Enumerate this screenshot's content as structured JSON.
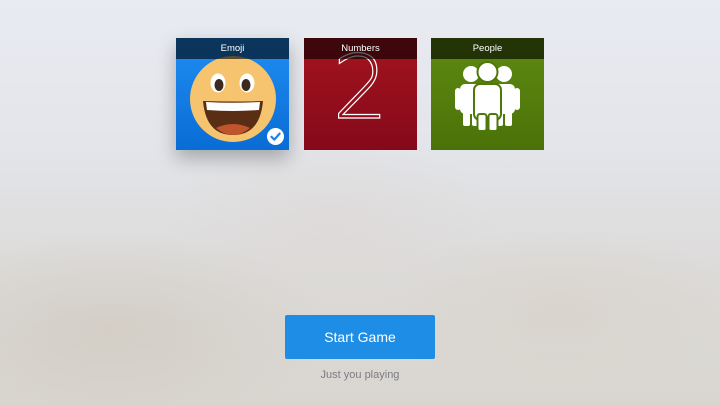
{
  "categories": [
    {
      "label": "Emoji",
      "icon": "smiley-emoji-icon",
      "color": "#1a84ec",
      "selected": true,
      "focused": true
    },
    {
      "label": "Numbers",
      "glyph": "2",
      "color": "#97101c",
      "selected": false
    },
    {
      "label": "People",
      "icon": "people-group-icon",
      "color": "#567f10",
      "selected": false
    }
  ],
  "start_button": {
    "label": "Start Game",
    "color": "#1e8de6"
  },
  "player_status": "Just you playing"
}
